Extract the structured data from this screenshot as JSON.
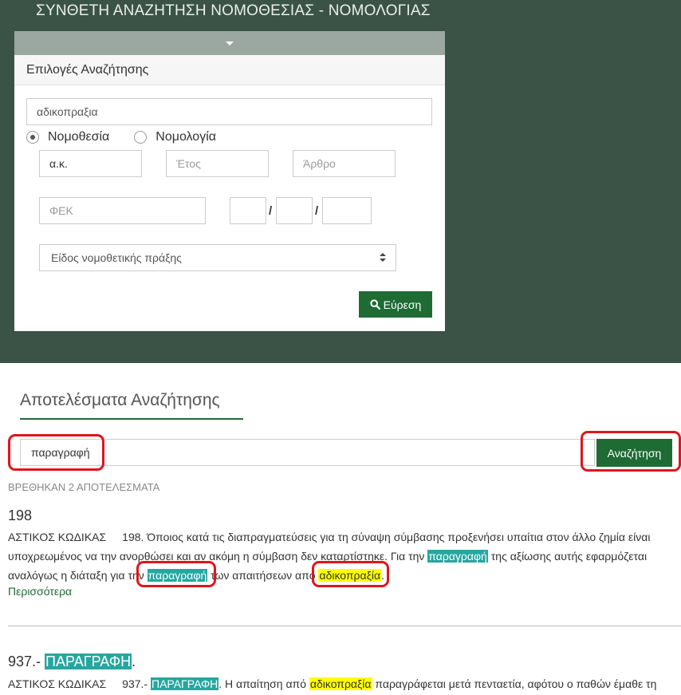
{
  "page_title": "ΣΥΝΘΕΤΗ ΑΝΑΖΗΤΗΣΗ ΝΟΜΟΘΕΣΙΑΣ - ΝΟΜΟΛΟΓΙΑΣ",
  "search_panel": {
    "heading": "Επιλογές Αναζήτησης",
    "keyword_value": "αδικοπραξια",
    "radio_legislation": "Νομοθεσία",
    "radio_case_law": "Νομολογία",
    "code_value": "α.κ.",
    "year_placeholder": "Έτος",
    "article_placeholder": "Άρθρο",
    "fek_placeholder": "ΦΕΚ",
    "date_separator": "/",
    "act_type_select": "Είδος νομοθετικής πράξης",
    "find_button": "Εύρεση"
  },
  "results": {
    "title": "Αποτελέσματα Αναζήτησης",
    "filter_value": "παραγραφή",
    "search_button": "Αναζήτηση",
    "count_text": "ΒΡΕΘΗΚΑΝ 2 ΑΠΟΤΕΛΕΣΜΑΤΑ",
    "more_link": "Περισσότερα",
    "items": [
      {
        "title": "198",
        "source": "ΑΣΤΙΚΟΣ ΚΩΔΙΚΑΣ",
        "t1": "198. Όποιος κατά τις διαπραγματεύσεις για τη σύναψη σύμβασης προξενήσει υπαίτια στον άλλο ζημία είναι υποχρεωμένος να την ανορθώσει και αν ακόμη η σύμβαση δεν καταρτίστηκε. Για την ",
        "h1": "παραγραφή",
        "t2": " της αξίωσης αυτής εφαρμόζεται αναλόγως η διάταξη για την ",
        "h2": "παραγραφή",
        "t3": " των απαιτήσεων από ",
        "h3": "αδικοπραξία",
        "t4": "."
      },
      {
        "title_prefix": "937.- ",
        "title_highlight": "ΠΑΡΑΓΡΑΦΗ",
        "title_suffix": ".",
        "source": "ΑΣΤΙΚΟΣ ΚΩΔΙΚΑΣ",
        "t1": "937.- ",
        "h1": "ΠΑΡΑΓΡΑΦΗ",
        "t2": ". Η απαίτηση από ",
        "h2": "αδικοπραξία",
        "t3": " παραγράφεται μετά πενταετία, αφότου ο παθών έμαθε τη"
      }
    ]
  }
}
